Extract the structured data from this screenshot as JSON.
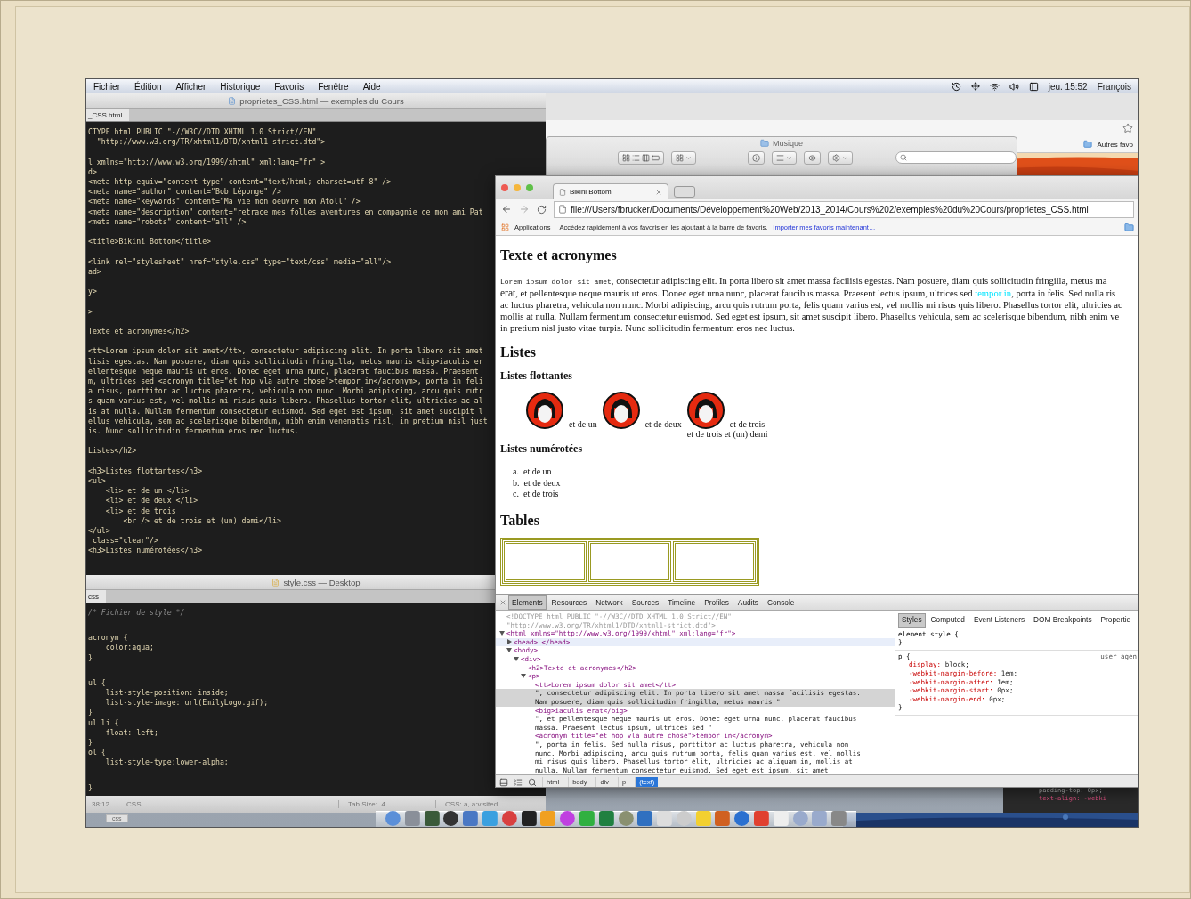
{
  "menu_bar": {
    "items": [
      "Fichier",
      "Édition",
      "Afficher",
      "Historique",
      "Favoris",
      "Fenêtre",
      "Aide"
    ],
    "clock": "jeu. 15:52",
    "user": "François"
  },
  "editor": {
    "title": "proprietes_CSS.html — exemples du Cours",
    "tab": "_CSS.html",
    "blocks": [
      {
        "kind": "code",
        "lines": [
          "CTYPE html PUBLIC \"-//W3C//DTD XHTML 1.0 Strict//EN\"",
          "  \"http://www.w3.org/TR/xhtml1/DTD/xhtml1-strict.dtd\">"
        ]
      },
      {
        "kind": "code",
        "lines": [
          "l xmlns=\"http://www.w3.org/1999/xhtml\" xml:lang=\"fr\" >",
          "d>",
          "<meta http-equiv=\"content-type\" content=\"text/html; charset=utf-8\" />",
          "<meta name=\"author\" content=\"Bob Léponge\" />",
          "<meta name=\"keywords\" content=\"Ma vie mon oeuvre mon Atoll\" />",
          "<meta name=\"description\" content=\"retrace mes folles aventures en compagnie de mon ami Pat",
          "<meta name=\"robots\" content=\"all\" />"
        ]
      },
      {
        "kind": "code",
        "lines": [
          "<title>Bikini Bottom</title>"
        ]
      },
      {
        "kind": "code",
        "lines": [
          "<link rel=\"stylesheet\" href=\"style.css\" type=\"text/css\" media=\"all\"/>",
          "ad>"
        ]
      },
      {
        "kind": "code",
        "lines": [
          "y>"
        ]
      },
      {
        "kind": "code",
        "lines": [
          ">"
        ]
      },
      {
        "kind": "code",
        "lines": [
          "Texte et acronymes</h2>"
        ]
      },
      {
        "kind": "code",
        "lines": [
          "<tt>Lorem ipsum dolor sit amet</tt>, consectetur adipiscing elit. In porta libero sit amet",
          "lisis egestas. Nam posuere, diam quis sollicitudin fringilla, metus mauris <big>iaculis er",
          "ellentesque neque mauris ut eros. Donec eget urna nunc, placerat faucibus massa. Praesent",
          "m, ultrices sed <acronym title=\"et hop vla autre chose\">tempor in</acronym>, porta in feli",
          "a risus, porttitor ac luctus pharetra, vehicula non nunc. Morbi adipiscing, arcu quis rutr",
          "s quam varius est, vel mollis mi risus quis libero. Phasellus tortor elit, ultricies ac al",
          "is at nulla. Nullam fermentum consectetur euismod. Sed eget est ipsum, sit amet suscipit l",
          "ellus vehicula, sem ac scelerisque bibendum, nibh enim venenatis nisl, in pretium nisl just",
          "is. Nunc sollicitudin fermentum eros nec luctus."
        ]
      },
      {
        "kind": "code",
        "lines": [
          "Listes</h2>"
        ]
      },
      {
        "kind": "code",
        "lines": [
          "<h3>Listes flottantes</h3>",
          "<ul>",
          "    <li> et de un </li>",
          "    <li> et de deux </li>",
          "    <li> et de trois",
          "        <br /> et de trois et (un) demi</li>",
          "</ul>",
          " class=\"clear\"/>",
          "<h3>Listes numérotées</h3>"
        ]
      }
    ]
  },
  "css_editor": {
    "title": "style.css — Desktop",
    "tab": "css",
    "blocks": [
      {
        "kind": "comment",
        "lines": [
          "/* Fichier de style */"
        ]
      },
      {
        "kind": "code",
        "lines": [
          "acronym {",
          "    color:aqua;",
          "}"
        ]
      },
      {
        "kind": "code",
        "lines": [
          "ul {",
          "    list-style-position: inside;",
          "    list-style-image: url(EmilyLogo.gif);",
          "}",
          "ul li {",
          "    float: left;",
          "}",
          "ol {",
          "    list-style-type:lower-alpha;"
        ]
      },
      {
        "kind": "code",
        "lines": [
          "}"
        ]
      }
    ],
    "status_bar": {
      "position": "38:12",
      "syntax": "CSS",
      "tab_size_label": "Tab Size:",
      "tab_size": "4",
      "symbol": "CSS: a, a:visited"
    }
  },
  "desktop_tab": "css",
  "back_browser": {
    "bookmark_folder": "Autres favo"
  },
  "finder": {
    "title": "Musique"
  },
  "browser": {
    "tab": "Bikini Bottom",
    "url": "file:///Users/fbrucker/Documents/Développement%20Web/2013_2014/Cours%202/exemples%20du%20Cours/proprietes_CSS.html",
    "bookmarks_bar": {
      "apps": "Applications",
      "hint": "Accédez rapidement à vos favoris en les ajoutant à la barre de favoris.",
      "import_link": "Importer mes favoris maintenant…"
    },
    "page": {
      "heading_text": "Texte et acronymes",
      "paragraph_lines": [
        {
          "parts": [
            {
              "kind": "tt",
              "text": "Lorem ipsum dolor sit amet"
            },
            {
              "kind": "plain",
              "text": ", consectetur adipiscing elit. In porta libero sit amet massa facilisis egestas. Nam posuere, diam quis sollicitudin fringilla, metus ma"
            }
          ]
        },
        {
          "parts": [
            {
              "kind": "big",
              "text": "erat"
            },
            {
              "kind": "plain",
              "text": ", et pellentesque neque mauris ut eros. Donec eget urna nunc, placerat faucibus massa. Praesent lectus ipsum, ultrices sed "
            },
            {
              "kind": "acronym",
              "text": "tempor in"
            },
            {
              "kind": "plain",
              "text": ", porta in felis. Sed nulla ris"
            }
          ]
        },
        {
          "parts": [
            {
              "kind": "plain",
              "text": "ac luctus pharetra, vehicula non nunc. Morbi adipiscing, arcu quis rutrum porta, felis quam varius est, vel mollis mi risus quis libero. Phasellus tortor elit, ultricies ac"
            }
          ]
        },
        {
          "parts": [
            {
              "kind": "plain",
              "text": "mollis at nulla. Nullam fermentum consectetur euismod. Sed eget est ipsum, sit amet suscipit libero. Phasellus vehicula, sem ac scelerisque bibendum, nibh enim ve"
            }
          ]
        },
        {
          "parts": [
            {
              "kind": "plain",
              "text": "in pretium nisl justo vitae turpis. Nunc sollicitudin fermentum eros nec luctus."
            }
          ]
        }
      ],
      "heading_lists": "Listes",
      "heading_float": "Listes flottantes",
      "float_items": [
        {
          "lines": [
            "et de un"
          ]
        },
        {
          "lines": [
            "et de deux"
          ]
        },
        {
          "lines": [
            "et de trois",
            "et de trois et (un) demi"
          ]
        }
      ],
      "heading_numbered": "Listes numérotées",
      "numbered_items": [
        {
          "marker": "a.",
          "text": "et de un"
        },
        {
          "marker": "b.",
          "text": "et de deux"
        },
        {
          "marker": "c.",
          "text": "et de trois"
        }
      ],
      "heading_tables": "Tables"
    },
    "devtools": {
      "tabs": [
        {
          "label": "Elements",
          "selected": true
        },
        {
          "label": "Resources",
          "selected": false
        },
        {
          "label": "Network",
          "selected": false
        },
        {
          "label": "Sources",
          "selected": false
        },
        {
          "label": "Timeline",
          "selected": false
        },
        {
          "label": "Profiles",
          "selected": false
        },
        {
          "label": "Audits",
          "selected": false
        },
        {
          "label": "Console",
          "selected": false
        }
      ],
      "dom": [
        {
          "kind": "doctype",
          "selected": false,
          "hovered": false,
          "lines": [
            "<!DOCTYPE html PUBLIC \"-//W3C//DTD XHTML 1.0 Strict//EN\"",
            "\"http://www.w3.org/TR/xhtml1/DTD/xhtml1-strict.dtd\">"
          ]
        },
        {
          "kind": "element",
          "selected": false,
          "hovered": false,
          "expanded": true,
          "lines": [
            "<html xmlns=\"http://www.w3.org/1999/xhtml\" xml:lang=\"fr\">"
          ],
          "children": [
            {
              "kind": "element",
              "selected": false,
              "hovered": true,
              "expanded": false,
              "lines": [
                "<head>…</head>"
              ]
            },
            {
              "kind": "element",
              "selected": false,
              "hovered": false,
              "expanded": true,
              "lines": [
                "<body>"
              ],
              "children": [
                {
                  "kind": "element",
                  "selected": false,
                  "hovered": false,
                  "expanded": true,
                  "lines": [
                    "<div>"
                  ],
                  "children": [
                    {
                      "kind": "element",
                      "selected": false,
                      "hovered": false,
                      "lines": [
                        "<h2>Texte et acronymes</h2>"
                      ]
                    },
                    {
                      "kind": "element",
                      "selected": false,
                      "hovered": false,
                      "expanded": true,
                      "lines": [
                        "<p>"
                      ],
                      "children": [
                        {
                          "kind": "element",
                          "selected": false,
                          "hovered": false,
                          "lines": [
                            "<tt>Lorem ipsum dolor sit amet</tt>"
                          ]
                        },
                        {
                          "kind": "text",
                          "selected": true,
                          "hovered": false,
                          "lines": [
                            "\", consectetur adipiscing elit. In porta libero sit amet massa facilisis egestas.",
                            "Nam posuere, diam quis sollicitudin fringilla, metus mauris \""
                          ]
                        },
                        {
                          "kind": "element",
                          "selected": false,
                          "hovered": false,
                          "lines": [
                            "<big>iaculis erat</big>"
                          ]
                        },
                        {
                          "kind": "text",
                          "selected": false,
                          "hovered": false,
                          "lines": [
                            "\", et pellentesque neque mauris ut eros. Donec eget urna nunc, placerat faucibus",
                            "massa. Praesent lectus ipsum, ultrices sed \""
                          ]
                        },
                        {
                          "kind": "element",
                          "selected": false,
                          "hovered": false,
                          "lines": [
                            "<acronym title=\"et hop vla autre chose\">tempor in</acronym>"
                          ]
                        },
                        {
                          "kind": "text",
                          "selected": false,
                          "hovered": false,
                          "lines": [
                            "\", porta in felis. Sed nulla risus, porttitor ac luctus pharetra, vehicula non",
                            "nunc. Morbi adipiscing, arcu quis rutrum porta, felis quam varius est, vel mollis",
                            "mi risus quis libero. Phasellus tortor elit, ultricies ac aliquam in, mollis at",
                            "nulla. Nullam fermentum consectetur euismod. Sed eget est ipsum, sit amet"
                          ]
                        }
                      ]
                    }
                  ]
                }
              ]
            }
          ]
        }
      ],
      "styles_tabs": [
        {
          "label": "Styles",
          "selected": true
        },
        {
          "label": "Computed",
          "selected": false
        },
        {
          "label": "Event Listeners",
          "selected": false
        },
        {
          "label": "DOM Breakpoints",
          "selected": false
        },
        {
          "label": "Propertie",
          "selected": false
        }
      ],
      "rules": [
        {
          "selector": "element.style {",
          "close": "}"
        },
        {
          "selector": "p {",
          "origin": "user agen",
          "declarations": [
            {
              "property": "display:",
              "value": "block;"
            },
            {
              "property": "-webkit-margin-before:",
              "value": "1em;"
            },
            {
              "property": "-webkit-margin-after:",
              "value": "1em;"
            },
            {
              "property": "-webkit-margin-start:",
              "value": "0px;"
            },
            {
              "property": "-webkit-margin-end:",
              "value": "0px;"
            }
          ],
          "close": "}"
        }
      ],
      "breadcrumbs": [
        {
          "label": "html",
          "selected": false
        },
        {
          "label": "body",
          "selected": false
        },
        {
          "label": "div",
          "selected": false
        },
        {
          "label": "p",
          "selected": false
        },
        {
          "label": "(text)",
          "selected": true
        }
      ]
    }
  },
  "back_code": [
    "padding-top: 0px;",
    "text-align: -webki"
  ]
}
